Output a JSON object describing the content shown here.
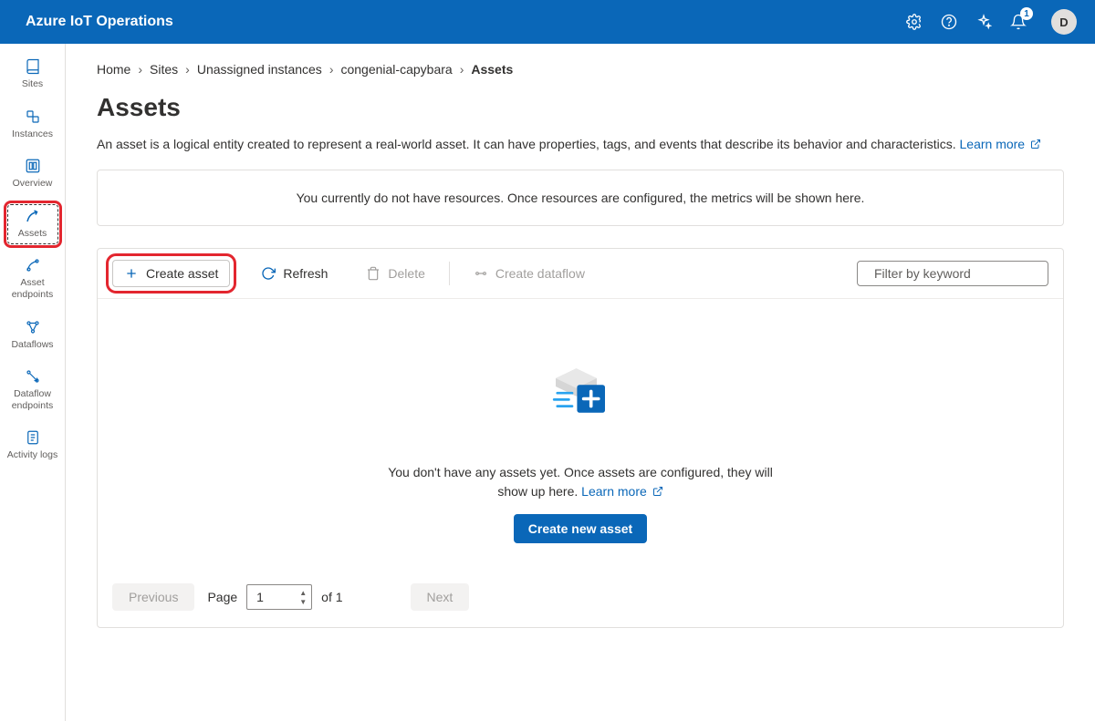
{
  "header": {
    "title": "Azure IoT Operations",
    "notification_count": "1",
    "avatar_letter": "D"
  },
  "sidebar": {
    "items": [
      {
        "label": "Sites",
        "icon": "book-icon"
      },
      {
        "label": "Instances",
        "icon": "instances-icon"
      },
      {
        "label": "Overview",
        "icon": "overview-icon"
      },
      {
        "label": "Assets",
        "icon": "asset-icon",
        "active": true,
        "highlighted": true
      },
      {
        "label": "Asset endpoints",
        "icon": "endpoint-icon"
      },
      {
        "label": "Dataflows",
        "icon": "dataflow-icon"
      },
      {
        "label": "Dataflow endpoints",
        "icon": "dfendpoint-icon"
      },
      {
        "label": "Activity logs",
        "icon": "logs-icon"
      }
    ]
  },
  "breadcrumb": {
    "items": [
      "Home",
      "Sites",
      "Unassigned instances",
      "congenial-capybara"
    ],
    "current": "Assets"
  },
  "page": {
    "title": "Assets",
    "description": "An asset is a logical entity created to represent a real-world asset. It can have properties, tags, and events that describe its behavior and characteristics.",
    "learn_more": "Learn more",
    "banner": "You currently do not have resources. Once resources are configured, the metrics will be shown here."
  },
  "toolbar": {
    "create": "Create asset",
    "refresh": "Refresh",
    "delete": "Delete",
    "create_dataflow": "Create dataflow",
    "filter_placeholder": "Filter by keyword"
  },
  "empty": {
    "text_a": "You don't have any assets yet. Once assets are configured, they will show up here.",
    "learn_more": "Learn more",
    "cta": "Create new asset"
  },
  "paging": {
    "prev": "Previous",
    "next": "Next",
    "page_label": "Page",
    "page_value": "1",
    "of_total": "of 1"
  }
}
